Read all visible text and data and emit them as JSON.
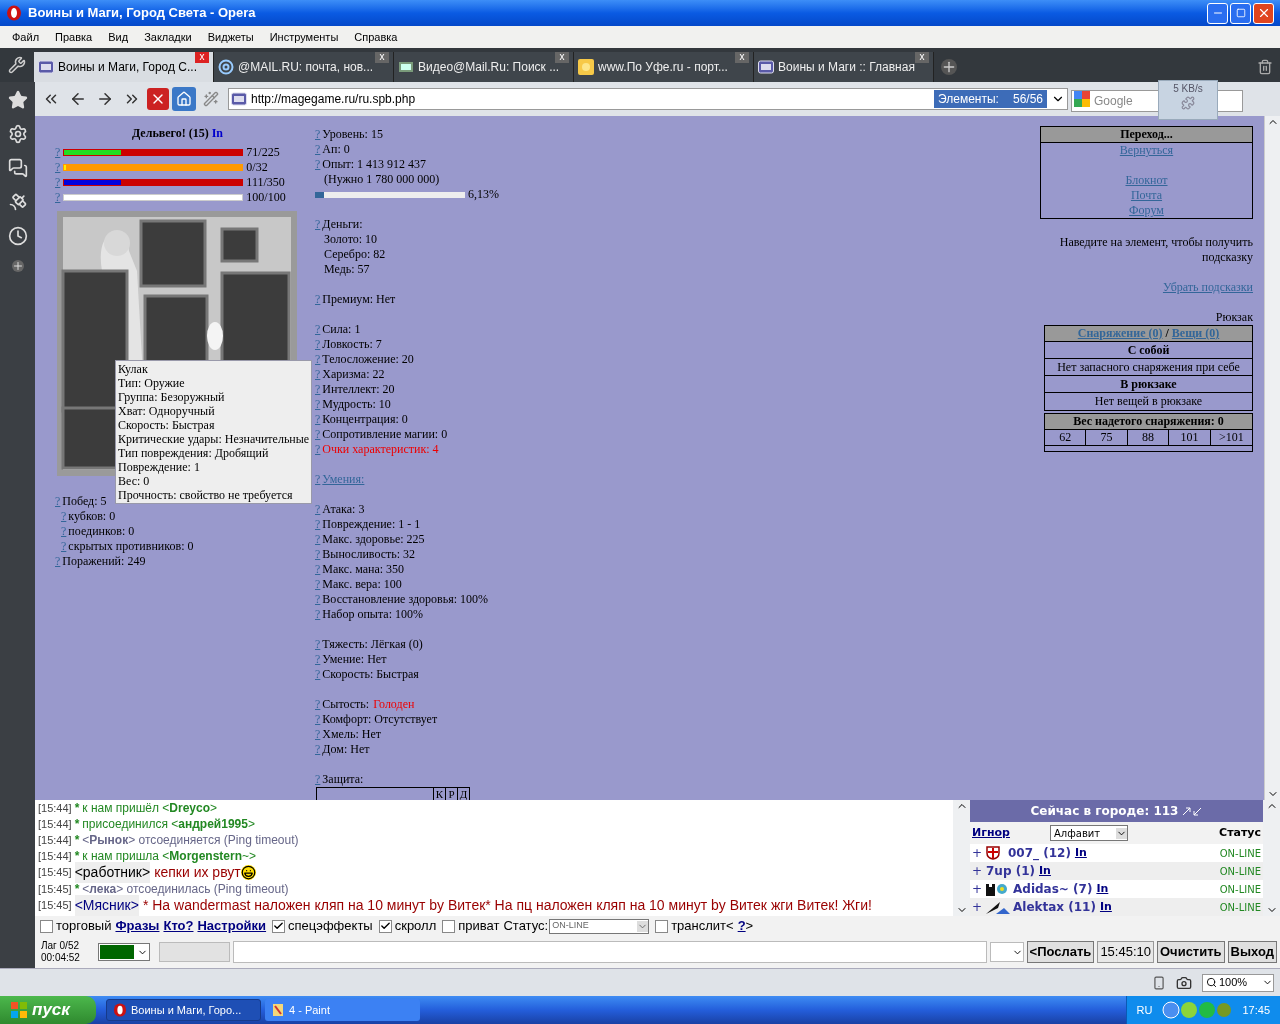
{
  "window": {
    "title": "Воины и Маги, Город Света - Opera"
  },
  "menu": [
    "Файл",
    "Правка",
    "Вид",
    "Закладки",
    "Виджеты",
    "Инструменты",
    "Справка"
  ],
  "tabs": [
    {
      "title": "Воины и Маги, Город С...",
      "selected": true,
      "close": "x"
    },
    {
      "title": "@MAIL.RU: почта, нов...",
      "selected": false,
      "close": "x"
    },
    {
      "title": "Видео@Mail.Ru: Поиск ...",
      "selected": false,
      "close": "x"
    },
    {
      "title": "www.По Уфе.ru - порт...",
      "selected": false,
      "close": "x"
    },
    {
      "title": "Воины и Маги :: Главная",
      "selected": false,
      "close": "x"
    }
  ],
  "address": {
    "url": "http://magegame.ru/ru.spb.php",
    "elements_label": "Элементы:",
    "elements_count": "56/56",
    "search_placeholder": "Google",
    "speed": "5 KB/s"
  },
  "character": {
    "name": "Дельвего! (15)",
    "link": "In",
    "bars": [
      {
        "kind": "health",
        "help": "?",
        "level": 0.3156,
        "reading": "71/225"
      },
      {
        "kind": "energy",
        "help": "?",
        "level": 0,
        "reading": "0/32"
      },
      {
        "kind": "mana",
        "help": "?",
        "level": 0.3171,
        "reading": "111/350"
      },
      {
        "kind": "faith",
        "help": "?",
        "level": 1,
        "reading": "100/100"
      }
    ],
    "records": [
      {
        "help": "?",
        "text": "Побед: 5",
        "indent": false
      },
      {
        "help": "?",
        "text": "кубков: 0",
        "indent": true
      },
      {
        "help": "?",
        "text": "поединков: 0",
        "indent": true
      },
      {
        "help": "?",
        "text": "скрытых противников: 0",
        "indent": true
      },
      {
        "help": "?",
        "text": "Поражений: 249",
        "indent": false
      }
    ],
    "tooltip": [
      "Кулак",
      "Тип: Оружие",
      "Группа: Безоружный",
      "Хват: Одноручный",
      "Скорость: Быстрая",
      "Критические удары: Незначительные",
      "Тип повреждения: Дробящий",
      "Повреждение: 1",
      "Вес: 0",
      "Прочность: свойство не требуется"
    ]
  },
  "stats": [
    [
      {
        "kind": "line",
        "help": "?",
        "text": "Уровень: 15"
      },
      {
        "kind": "line",
        "help": "?",
        "text": "Ап: 0"
      },
      {
        "kind": "line",
        "help": "?",
        "text": "Опыт: 1 413 912 437"
      },
      {
        "kind": "sub",
        "text": "(Нужно 1 780 000 000)"
      },
      {
        "kind": "bar",
        "level": 0.0613,
        "reading": "6,13%"
      }
    ],
    [
      {
        "kind": "line",
        "help": "?",
        "text": "Деньги:"
      },
      {
        "kind": "sub",
        "text": "Золото: 10"
      },
      {
        "kind": "sub",
        "text": "Серебро: 82"
      },
      {
        "kind": "sub",
        "text": "Медь: 57"
      }
    ],
    [
      {
        "kind": "line",
        "help": "?",
        "text": "Премиум: Нет"
      }
    ],
    [
      {
        "kind": "line",
        "help": "?",
        "text": "Сила: 1"
      },
      {
        "kind": "line",
        "help": "?",
        "text": "Ловкость: 7"
      },
      {
        "kind": "line",
        "help": "?",
        "text": "Телосложение: 20"
      },
      {
        "kind": "line",
        "help": "?",
        "text": "Харизма: 22"
      },
      {
        "kind": "line",
        "help": "?",
        "text": "Интеллект: 20"
      },
      {
        "kind": "line",
        "help": "?",
        "text": "Мудрость: 10"
      },
      {
        "kind": "line",
        "help": "?",
        "text": "Концентрация: 0"
      },
      {
        "kind": "line",
        "help": "?",
        "text": "Сопротивление магии: 0"
      },
      {
        "kind": "alert",
        "help": "?",
        "text": "Очки характеристик: 4"
      }
    ],
    [
      {
        "kind": "link",
        "help": "?",
        "text": "Умения:"
      }
    ],
    [
      {
        "kind": "line",
        "help": "?",
        "text": "Атака: 3"
      },
      {
        "kind": "line",
        "help": "?",
        "text": "Повреждение: 1 - 1"
      },
      {
        "kind": "line",
        "help": "?",
        "text": "Макс. здоровье: 225"
      },
      {
        "kind": "line",
        "help": "?",
        "text": "Выносливость: 32"
      },
      {
        "kind": "line",
        "help": "?",
        "text": "Макс. мана: 350"
      },
      {
        "kind": "line",
        "help": "?",
        "text": "Макс. вера: 100"
      },
      {
        "kind": "line",
        "help": "?",
        "text": "Восстановление здоровья: 100%"
      },
      {
        "kind": "line",
        "help": "?",
        "text": "Набор опыта: 100%"
      }
    ],
    [
      {
        "kind": "line",
        "help": "?",
        "text": "Тяжесть: Лёгкая (0)"
      },
      {
        "kind": "line",
        "help": "?",
        "text": "Умение: Нет"
      },
      {
        "kind": "line",
        "help": "?",
        "text": "Скорость: Быстрая"
      }
    ],
    [
      {
        "kind": "status",
        "help": "?",
        "text": "Сытость:",
        "value": "Голоден"
      },
      {
        "kind": "line",
        "help": "?",
        "text": "Комфорт: Отсутствует"
      },
      {
        "kind": "line",
        "help": "?",
        "text": "Хмель: Нет"
      },
      {
        "kind": "line",
        "help": "?",
        "text": "Дом: Нет"
      }
    ],
    [
      {
        "kind": "line",
        "help": "?",
        "text": "Защита:"
      },
      {
        "kind": "table",
        "cells": [
          "К",
          "Р",
          "Д"
        ]
      }
    ]
  ],
  "navigation": {
    "title": "Переход...",
    "links": [
      "Вернуться",
      "Блокнот",
      "Почта",
      "Форум"
    ]
  },
  "hint": {
    "text": "Наведите на элемент, чтобы получить подсказку",
    "link": "Убрать подсказки"
  },
  "backpack": {
    "title": "Рюкзак",
    "tab_links": [
      "Снаряжение (0)",
      "Вещи (0)"
    ],
    "separator": "/",
    "rows": [
      {
        "kind": "heading",
        "text": "С собой"
      },
      {
        "kind": "note",
        "text": "Нет запасного снаряжения при себе"
      },
      {
        "kind": "heading",
        "text": "В рюкзаке"
      },
      {
        "kind": "note",
        "text": "Нет вещей в рюкзаке"
      }
    ],
    "weight_title": "Вес надетого снаряжения: 0",
    "weight_steps": [
      "62",
      "75",
      "88",
      "101",
      ">101"
    ]
  },
  "chat": {
    "messages": [
      {
        "kind": "join",
        "time": "[15:44]",
        "mark": "*",
        "text": "к нам пришёл <**Dreyco**>"
      },
      {
        "kind": "join",
        "time": "[15:44]",
        "mark": "*",
        "text": "присоединился <**андрей1995**>"
      },
      {
        "kind": "leave",
        "time": "[15:44]",
        "mark": "*",
        "text": "<**Рынок**> отсоединяется (Ping timeout)"
      },
      {
        "kind": "join",
        "time": "[15:44]",
        "mark": "*",
        "text": "к нам пришла <**Morgenstern**~>"
      },
      {
        "kind": "say",
        "time": "[15:45]",
        "nick": "<работник>",
        "color": "#000000",
        "text": "кепки их рвут",
        "smiley": true
      },
      {
        "kind": "leave",
        "time": "[15:45]",
        "mark": "*",
        "text": "<**лека**> отсоединилась (Ping timeout)"
      },
      {
        "kind": "say",
        "time": "[15:45]",
        "nick": "<Мясник>",
        "color": "#000080",
        "text": "* На wandermast наложен кляп на 10 минут by Витек* На пц наложен кляп на 10 минут by Витек жги Витек! Жги!",
        "smiley": false
      }
    ],
    "controls": [
      {
        "kind": "checkbox",
        "label": "торговый",
        "checked": false
      },
      {
        "kind": "link",
        "label": "Фразы"
      },
      {
        "kind": "link",
        "label": "Кто?"
      },
      {
        "kind": "link",
        "label": "Настройки"
      },
      {
        "kind": "checkbox",
        "label": "спецэффекты",
        "checked": true
      },
      {
        "kind": "checkbox",
        "label": "скролл",
        "checked": true
      },
      {
        "kind": "checkbox",
        "label": "приват",
        "checked": false
      },
      {
        "kind": "select",
        "label": "Статус:",
        "value": "ON-LINE"
      },
      {
        "kind": "checkbox",
        "label": "транслит<",
        "checked": false
      },
      {
        "kind": "link",
        "label": "?"
      },
      {
        "kind": "text",
        "label": ">"
      }
    ],
    "lag": "Лаг 0/52",
    "timer": "00:04:52",
    "buttons": [
      {
        "kind": "button",
        "label": "<Послать"
      },
      {
        "kind": "clock",
        "label": "15:45:10"
      },
      {
        "kind": "button",
        "label": "Очистить"
      },
      {
        "kind": "button",
        "label": "Выход"
      }
    ]
  },
  "online": {
    "title": "Сейчас в городе: 113",
    "ignore": "Игнор",
    "sort": "Алфавит",
    "status_heading": "Статус",
    "users": [
      {
        "plus": "+",
        "name": "007_ (12)",
        "link": "In",
        "status": "ON-LINE"
      },
      {
        "plus": "+",
        "name": "7up (1)",
        "link": "In",
        "status": "ON-LINE"
      },
      {
        "plus": "+",
        "name": "Adidas~ (7)",
        "link": "In",
        "status": "ON-LINE"
      },
      {
        "plus": "+",
        "name": "Alektax (11)",
        "link": "In",
        "status": "ON-LINE"
      }
    ]
  },
  "status_bar": {
    "zoom": "100%"
  },
  "taskbar": {
    "start": "пуск",
    "tasks": [
      {
        "title": "Воины и Маги, Горо...",
        "selected": true
      },
      {
        "title": "4 - Paint",
        "selected": false
      }
    ],
    "language": "RU",
    "clock": "17:45"
  }
}
